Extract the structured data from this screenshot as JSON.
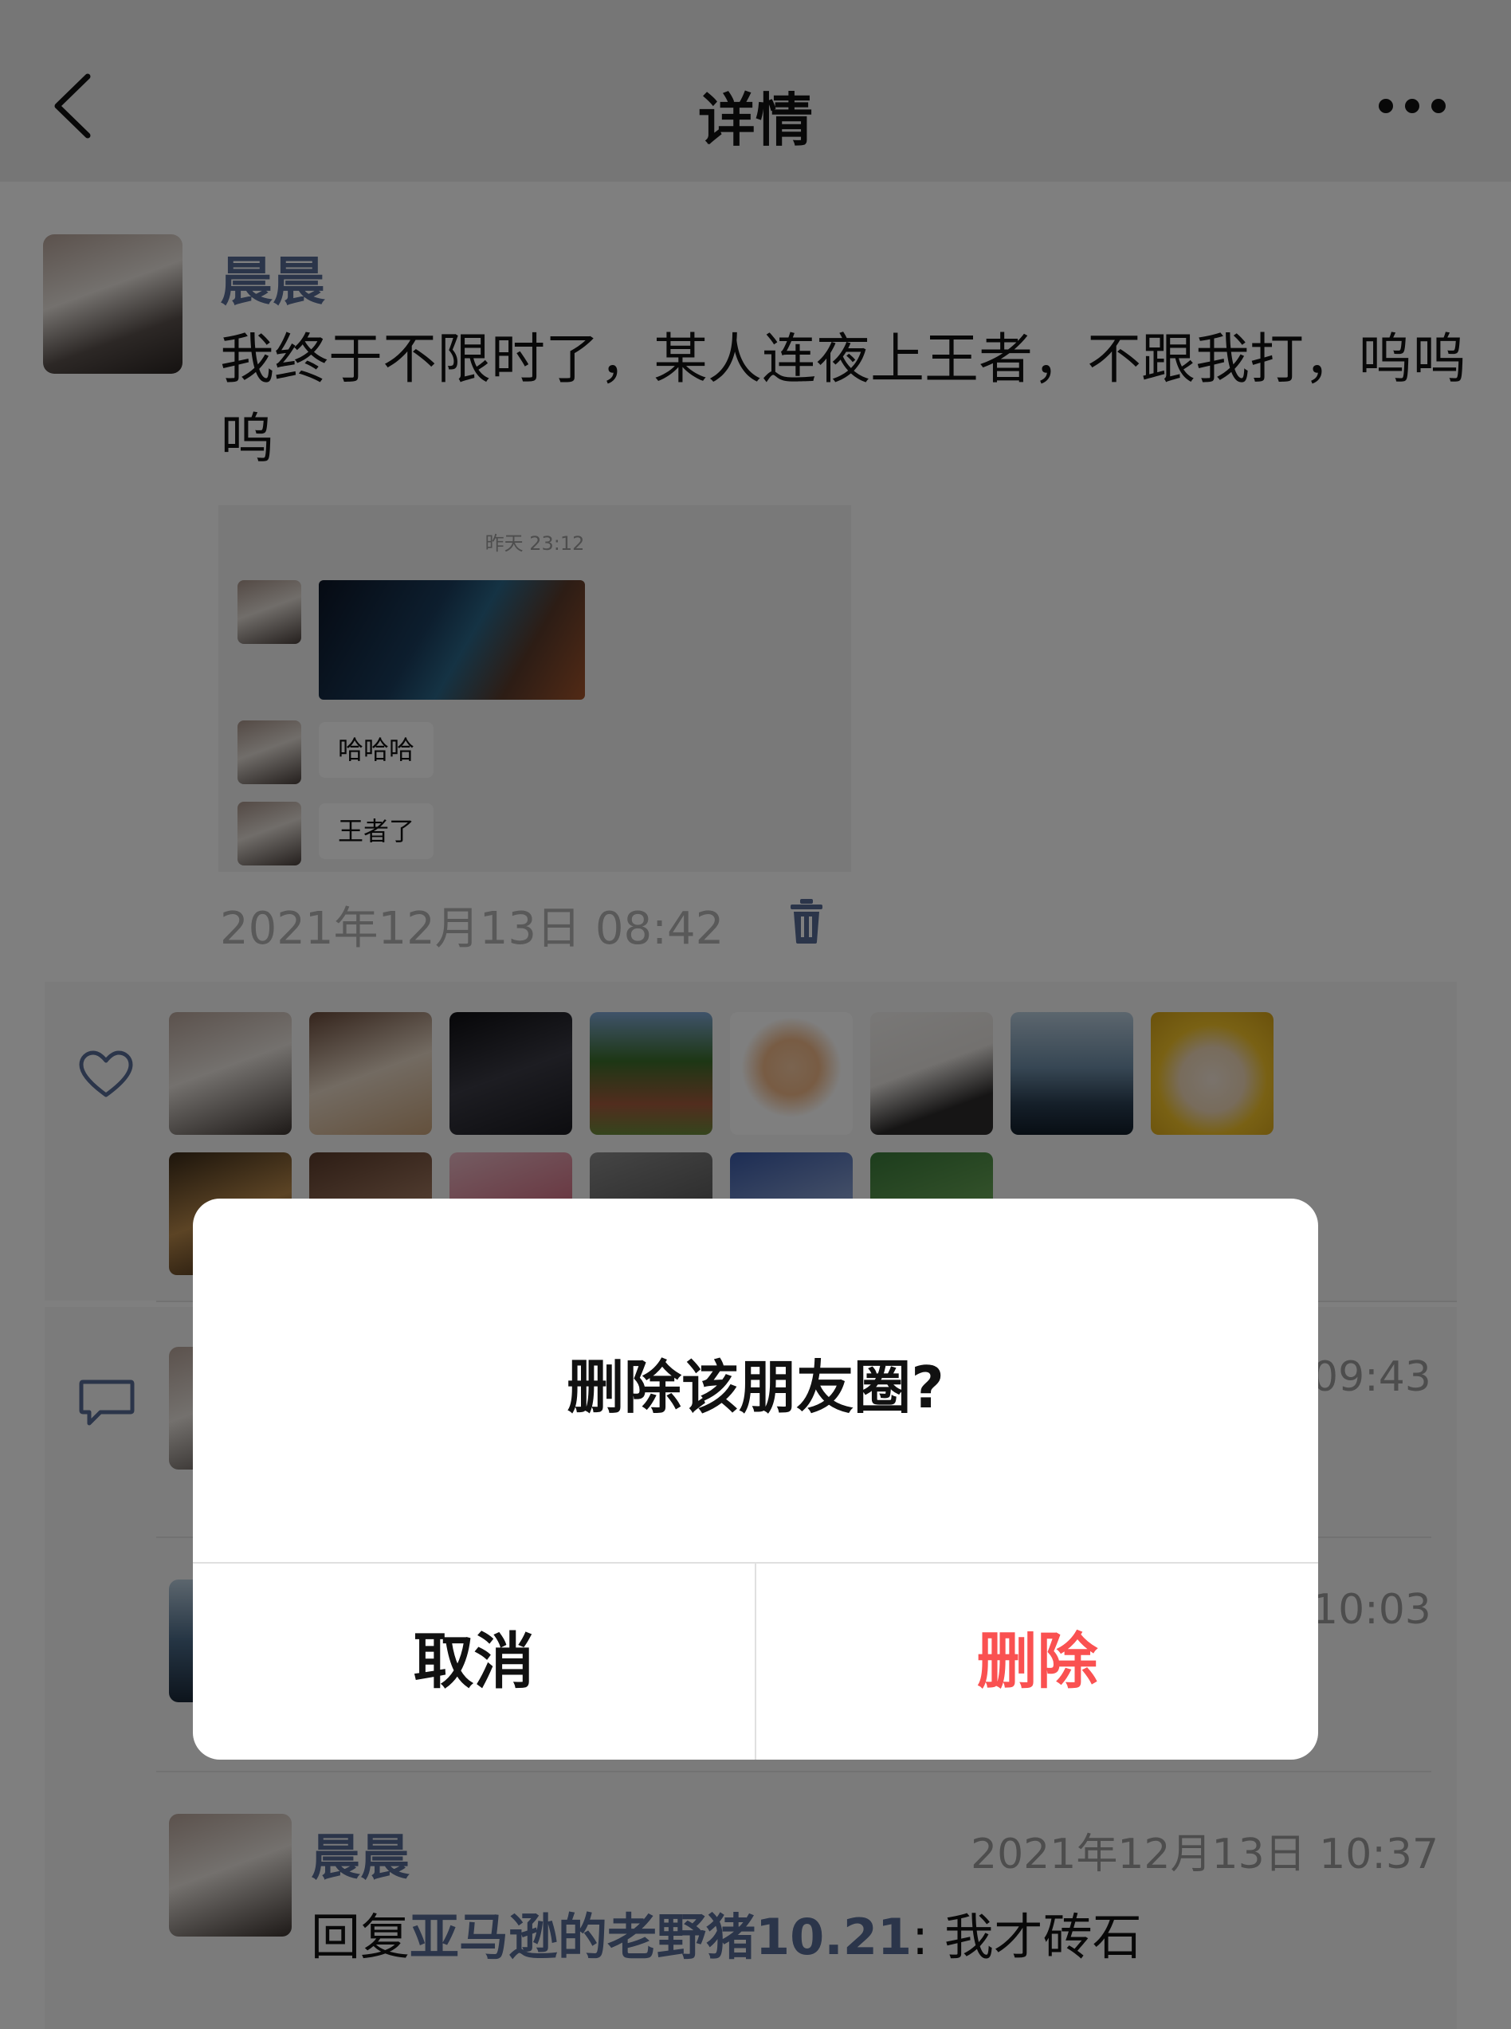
{
  "header": {
    "title": "详情"
  },
  "post": {
    "author": "晨晨",
    "text": "我终于不限时了，某人连夜上王者，不跟我打，呜呜呜",
    "time": "2021年12月13日 08:42",
    "screenshot": {
      "time": "昨天 23:12",
      "messages": [
        "哈哈哈",
        "王者了"
      ]
    }
  },
  "comments": {
    "partial_time_1": "09:43",
    "partial_time_2": "10:03",
    "last": {
      "name": "晨晨",
      "time": "2021年12月13日 10:37",
      "reply_prefix": "回复",
      "reply_to": "亚马逊的老野猪10.21",
      "reply_sep": ": ",
      "text": "我才砖石"
    }
  },
  "dialog": {
    "title": "删除该朋友圈?",
    "cancel_label": "取消",
    "delete_label": "删除"
  },
  "colors": {
    "link": "#576b95",
    "danger": "#fa5151",
    "overlay": "rgba(0,0,0,0.5)"
  }
}
